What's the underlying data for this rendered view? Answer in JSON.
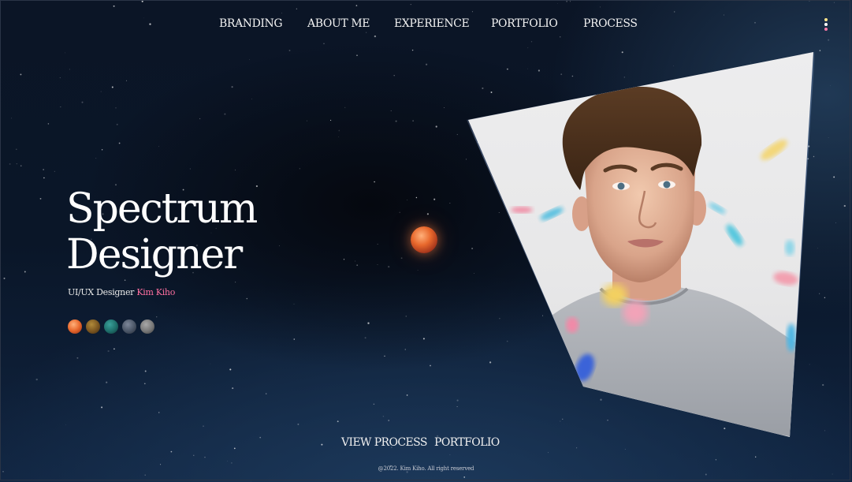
{
  "nav": {
    "items": [
      {
        "label": "BRANDING"
      },
      {
        "label": "ABOUT ME"
      },
      {
        "label": "EXPERIENCE"
      },
      {
        "label": "PORTFOLIO"
      },
      {
        "label": "PROCESS"
      }
    ],
    "menu_icon": "kebab-menu-icon",
    "menu_dot_colors": [
      "#ffe58a",
      "#ffffff",
      "#ff7aa8"
    ]
  },
  "hero": {
    "title_line1": "Spectrum",
    "title_line2": "Designer",
    "subtitle_prefix": "UI/UX Designer",
    "subtitle_name": "Kim Kiho",
    "name_color": "#ff6fa0"
  },
  "swatches": [
    {
      "name": "orange-planet",
      "color": "#e8682c"
    },
    {
      "name": "brown-planet",
      "color": "#7a5520"
    },
    {
      "name": "teal-planet",
      "color": "#1e6e6a"
    },
    {
      "name": "slate-planet",
      "color": "#4a5566"
    },
    {
      "name": "gray-planet",
      "color": "#777777"
    }
  ],
  "planet": {
    "name": "red-planet",
    "color": "#e8682c"
  },
  "portrait": {
    "name": "portrait-photo"
  },
  "bottom_links": [
    {
      "label": "VIEW PROCESS"
    },
    {
      "label": "PORTFOLIO"
    }
  ],
  "footer": {
    "text": "@2022. Kim Kiho. All right reserved"
  }
}
